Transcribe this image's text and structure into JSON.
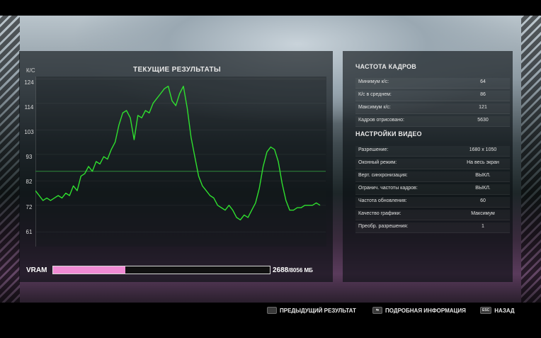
{
  "chart_title": "ТЕКУЩИЕ РЕЗУЛЬТАТЫ",
  "y_unit": "К/С",
  "y_ticks": [
    "124",
    "114",
    "103",
    "93",
    "82",
    "72",
    "61"
  ],
  "chart_data": {
    "type": "line",
    "title": "ТЕКУЩИЕ РЕЗУЛЬТАТЫ",
    "ylabel": "К/С",
    "ylim": [
      55,
      125
    ],
    "yticks": [
      124,
      114,
      103,
      93,
      82,
      72,
      61
    ],
    "reference_line": 86,
    "series_color": "#2fe02f",
    "series": [
      {
        "values": [
          78,
          76,
          74,
          75,
          74,
          75,
          76,
          75,
          77,
          76,
          80,
          78,
          84,
          85,
          88,
          86,
          90,
          89,
          92,
          91,
          95,
          98,
          105,
          110,
          111,
          108,
          99,
          109,
          108,
          111,
          110,
          114,
          116,
          118,
          120,
          121,
          115,
          113,
          118,
          121,
          112,
          100,
          92,
          84,
          80,
          78,
          76,
          75,
          72,
          71,
          70,
          72,
          70,
          67,
          66,
          68,
          67,
          70,
          73,
          79,
          88,
          94,
          96,
          95,
          90,
          81,
          74,
          70,
          70,
          71,
          71,
          72,
          72,
          72,
          73,
          72
        ]
      }
    ]
  },
  "vram": {
    "label": "VRAM",
    "used": "2688",
    "total": "/8056 МБ",
    "fraction": 0.3337,
    "fill_color": "#f08bd4"
  },
  "fps": {
    "title": "ЧАСТОТА КАДРОВ",
    "rows": [
      {
        "label": "Минимум к/с:",
        "value": "64"
      },
      {
        "label": "К/с в среднем:",
        "value": "86"
      },
      {
        "label": "Максимум к/с:",
        "value": "121"
      },
      {
        "label": "Кадров отрисовано:",
        "value": "5630"
      }
    ]
  },
  "video": {
    "title": "НАСТРОЙКИ ВИДЕО",
    "rows": [
      {
        "label": "Разрешение:",
        "value": "1680 x 1050"
      },
      {
        "label": "Оконный режим:",
        "value": "На весь экран"
      },
      {
        "label": "Верт. синхронизация:",
        "value": "ВЫКЛ."
      },
      {
        "label": "Огранич. частоты кадров:",
        "value": "ВЫКЛ."
      },
      {
        "label": "Частота обновления:",
        "value": "60"
      },
      {
        "label": "Качество графики:",
        "value": "Максимум"
      },
      {
        "label": "Преобр. разрешения:",
        "value": "1"
      }
    ]
  },
  "footer": {
    "prev_key": "",
    "prev_label": "ПРЕДЫДУЩИЙ РЕЗУЛЬТАТ",
    "details_key": "⇆",
    "details_label": "ПОДРОБНАЯ ИНФОРМАЦИЯ",
    "back_key": "ESC",
    "back_label": "НАЗАД"
  }
}
